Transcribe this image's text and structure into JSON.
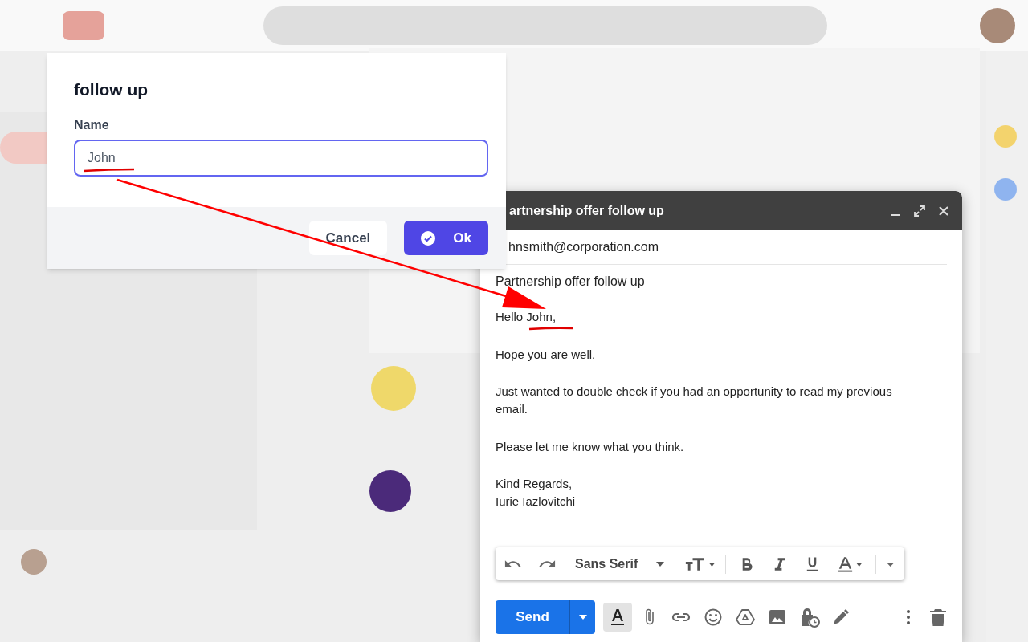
{
  "dialog": {
    "title": "follow up",
    "field": {
      "label": "Name",
      "value": "John"
    },
    "buttons": [
      {
        "label": "Cancel",
        "kind": "secondary"
      },
      {
        "label": "Ok",
        "kind": "primary"
      }
    ]
  },
  "compose": {
    "title": "artnership offer follow up",
    "to": "hnsmith@corporation.com",
    "subject": "Partnership offer follow up",
    "body": [
      {
        "lines": [
          "Hello John,"
        ]
      },
      {
        "lines": [
          "Hope you are well."
        ]
      },
      {
        "lines": [
          "Just wanted to double check if you had an opportunity to read my previous email."
        ]
      },
      {
        "lines": [
          "Please let me know what you think."
        ]
      },
      {
        "lines": [
          "Kind Regards,",
          "Iurie Iazlovitchi"
        ]
      }
    ],
    "formatting_open": true,
    "font": "Sans Serif",
    "send": "Send"
  }
}
